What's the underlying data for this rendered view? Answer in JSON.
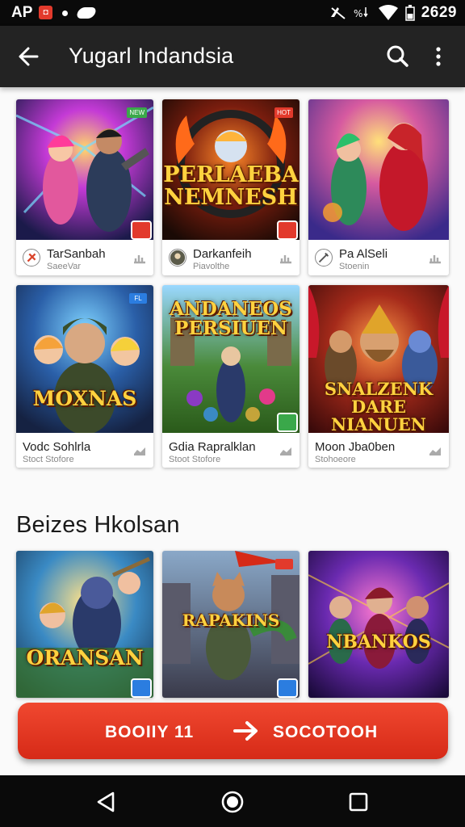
{
  "status_bar": {
    "app_label": "AP",
    "time": "2629"
  },
  "app_bar": {
    "title": "Yugarl Indandsia"
  },
  "featured": [
    {
      "art_title": "",
      "title": "TarSanbah",
      "subtitle": "SaeeVar",
      "tag": "NEW",
      "tag_color": "#3aa84a",
      "icon": "crosshair-icon"
    },
    {
      "art_title": "PERLAEBA NEMNESH",
      "title": "Darkanfeih",
      "subtitle": "Piavolthe",
      "tag": "HOT",
      "tag_color": "#e23a2c",
      "icon": "avatar-icon"
    },
    {
      "art_title": "",
      "title": "Pa AlSeli",
      "subtitle": "Stoenin",
      "tag": "",
      "tag_color": "#2b7de0",
      "icon": "sword-icon"
    },
    {
      "art_title": "MOXNAS",
      "title": "Vodc Sohlrla",
      "subtitle": "Stoct Stofore",
      "tag": "FL",
      "tag_color": "#2b7de0",
      "icon": ""
    },
    {
      "art_title": "ANDANEOS PERSIUEN",
      "title": "Gdia Rapralklan",
      "subtitle": "Stoot Stofore",
      "tag": "",
      "tag_color": "#3aa84a",
      "icon": ""
    },
    {
      "art_title": "SNALZENK DARE NIANUEN",
      "title": "Moon Jba0ben",
      "subtitle": "Stohoeore",
      "tag": "",
      "tag_color": "#e23a2c",
      "icon": ""
    }
  ],
  "section": {
    "title": "Beizes Hkolsan"
  },
  "more": [
    {
      "art_title": "ORANSAN"
    },
    {
      "art_title": "RAPAKINS"
    },
    {
      "art_title": "NBANKOS"
    }
  ],
  "cta": {
    "left_label": "BOOIIY 11",
    "right_label": "SOCOTOOH"
  },
  "colors": {
    "accent": "#e23a2c",
    "app_bar": "#232323",
    "status_bar": "#0a0a0a"
  }
}
